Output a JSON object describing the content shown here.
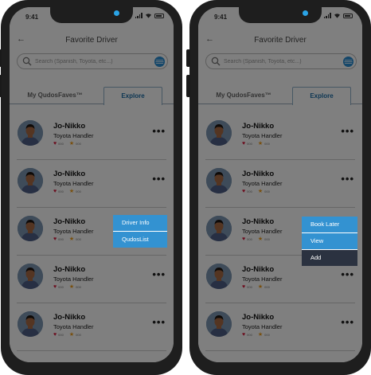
{
  "colors": {
    "accent_blue": "#3392d1",
    "tab_active": "#1d6ea8",
    "menu_dark": "#2b3240",
    "heart": "#d81b3c",
    "star": "#f0a01e"
  },
  "screens": [
    {
      "status_time": "9:41",
      "header": {
        "title": "Favorite Driver"
      },
      "search": {
        "placeholder": "Search (Spanish, Toyota, etc...)"
      },
      "tabs": [
        {
          "label": "My QudosFaves™"
        },
        {
          "label": "Explore"
        }
      ],
      "drivers": [
        {
          "name": "Jo-Nikko",
          "role": "Toyota Handler",
          "hearts": "000",
          "stars": "000"
        },
        {
          "name": "Jo-Nikko",
          "role": "Toyota Handler",
          "hearts": "000",
          "stars": "000"
        },
        {
          "name": "Jo-Nikko",
          "role": "Toyota Handler",
          "hearts": "000",
          "stars": "000"
        },
        {
          "name": "Jo-Nikko",
          "role": "Toyota Handler",
          "hearts": "000",
          "stars": "000"
        },
        {
          "name": "Jo-Nikko",
          "role": "Toyota Handler",
          "hearts": "000",
          "stars": "000"
        }
      ],
      "menu": [
        {
          "label": "Driver Info"
        },
        {
          "label": "QudosList"
        }
      ]
    },
    {
      "status_time": "9:41",
      "header": {
        "title": "Favorite Driver"
      },
      "search": {
        "placeholder": "Search (Spanish, Toyota, etc...)"
      },
      "tabs": [
        {
          "label": "My QudosFaves™"
        },
        {
          "label": "Explore"
        }
      ],
      "drivers": [
        {
          "name": "Jo-Nikko",
          "role": "Toyota Handler",
          "hearts": "000",
          "stars": "000"
        },
        {
          "name": "Jo-Nikko",
          "role": "Toyota Handler",
          "hearts": "000",
          "stars": "000"
        },
        {
          "name": "Jo-Nikko",
          "role": "Toyota Handler",
          "hearts": "000",
          "stars": "000"
        },
        {
          "name": "Jo-Nikko",
          "role": "Toyota Handler",
          "hearts": "000",
          "stars": "000"
        },
        {
          "name": "Jo-Nikko",
          "role": "Toyota Handler",
          "hearts": "000",
          "stars": "000"
        }
      ],
      "menu": [
        {
          "label": "Book Later"
        },
        {
          "label": "View"
        },
        {
          "label": "Add"
        }
      ]
    }
  ]
}
